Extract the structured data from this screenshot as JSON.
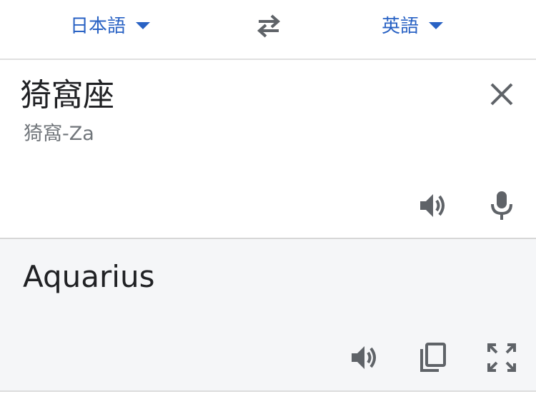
{
  "header": {
    "source_language": "日本語",
    "target_language": "英語"
  },
  "source": {
    "text": "猗窩座",
    "transliteration": "猗窩-Za"
  },
  "result": {
    "text": "Aquarius"
  },
  "icons": {
    "swap": "swap-arrows-icon",
    "clear": "close-icon",
    "source_speak": "speaker-icon",
    "mic": "microphone-icon",
    "result_speak": "speaker-icon",
    "copy": "copy-icon",
    "fullscreen": "fullscreen-icon"
  },
  "colors": {
    "accent": "#2962c4",
    "icon": "#5f6368",
    "result_bg": "#f5f6f8"
  }
}
